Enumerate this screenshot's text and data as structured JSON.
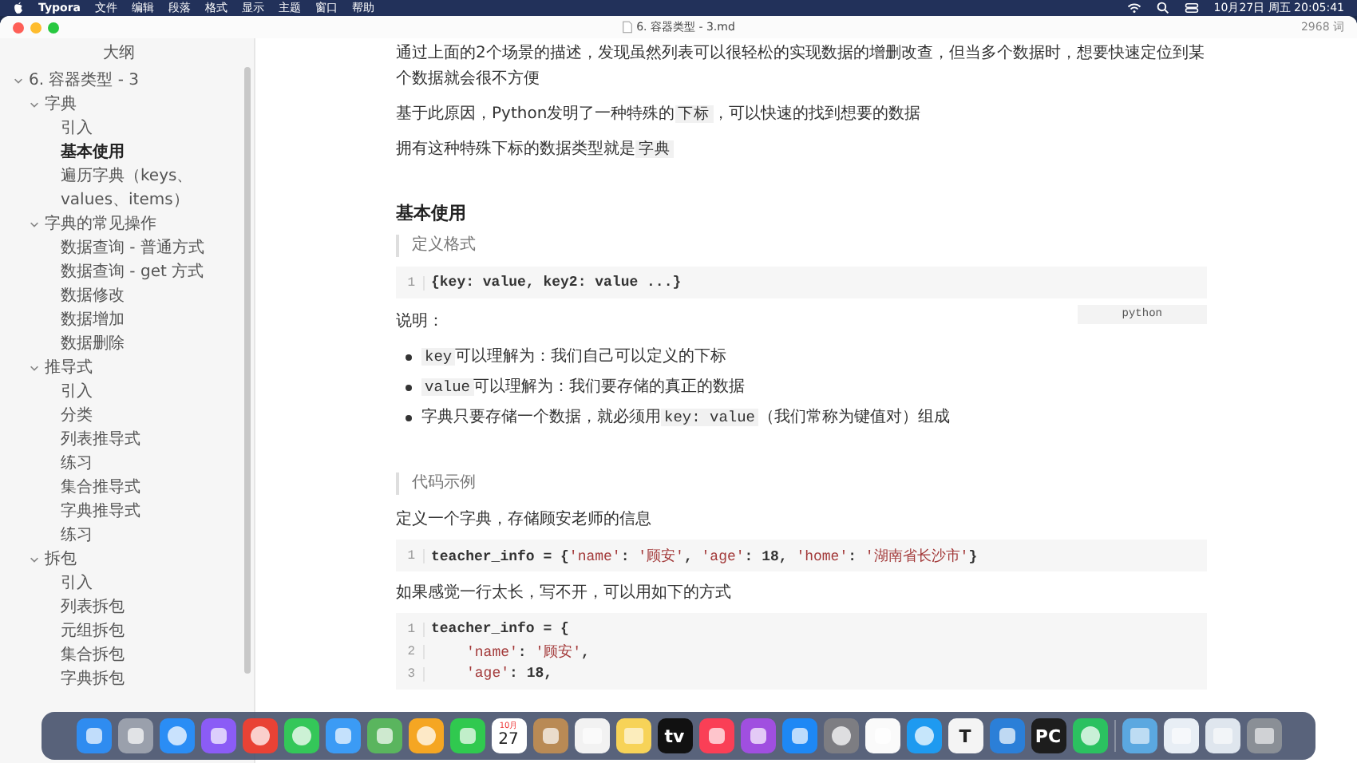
{
  "menubar": {
    "app": "Typora",
    "menus": [
      "文件",
      "编辑",
      "段落",
      "格式",
      "显示",
      "主题",
      "窗口",
      "帮助"
    ],
    "clock": "10月27日 周五  20:05:41"
  },
  "window": {
    "title": "6. 容器类型 - 3.md",
    "word_count": "2968 词"
  },
  "outline": {
    "title": "大纲",
    "items": [
      {
        "label": "6. 容器类型 - 3",
        "selected": false,
        "expanded": true,
        "children": [
          {
            "label": "字典",
            "selected": false,
            "expanded": true,
            "children": [
              {
                "label": "引入",
                "selected": false
              },
              {
                "label": "基本使用",
                "selected": true
              },
              {
                "label": "遍历字典（keys、values、items）",
                "selected": false
              }
            ]
          },
          {
            "label": "字典的常见操作",
            "selected": false,
            "expanded": true,
            "children": [
              {
                "label": "数据查询 - 普通方式",
                "selected": false
              },
              {
                "label": "数据查询 - get 方式",
                "selected": false
              },
              {
                "label": "数据修改",
                "selected": false
              },
              {
                "label": "数据增加",
                "selected": false
              },
              {
                "label": "数据删除",
                "selected": false
              }
            ]
          },
          {
            "label": "推导式",
            "selected": false,
            "expanded": true,
            "children": [
              {
                "label": "引入",
                "selected": false
              },
              {
                "label": "分类",
                "selected": false
              },
              {
                "label": "列表推导式",
                "selected": false
              },
              {
                "label": "练习",
                "selected": false
              },
              {
                "label": "集合推导式",
                "selected": false
              },
              {
                "label": "字典推导式",
                "selected": false
              },
              {
                "label": "练习",
                "selected": false
              }
            ]
          },
          {
            "label": "拆包",
            "selected": false,
            "expanded": true,
            "children": [
              {
                "label": "引入",
                "selected": false
              },
              {
                "label": "列表拆包",
                "selected": false
              },
              {
                "label": "元组拆包",
                "selected": false
              },
              {
                "label": "集合拆包",
                "selected": false
              },
              {
                "label": "字典拆包",
                "selected": false
              }
            ]
          }
        ]
      }
    ]
  },
  "document": [
    {
      "kind": "paragraph",
      "parts": [
        {
          "kind": "text",
          "text": "通过上面的2个场景的描述，发现虽然列表可以很轻松的实现数据的增删改查，但当多个数据时，想要快速定位到某个数据就会很不方便"
        }
      ]
    },
    {
      "kind": "paragraph",
      "parts": [
        {
          "kind": "text",
          "text": "基于此原因，Python发明了一种特殊的"
        },
        {
          "kind": "code",
          "text": "下标"
        },
        {
          "kind": "text",
          "text": "，可以快速的找到想要的数据"
        }
      ]
    },
    {
      "kind": "paragraph",
      "parts": [
        {
          "kind": "text",
          "text": "拥有这种特殊下标的数据类型就是"
        },
        {
          "kind": "code",
          "text": "字典"
        }
      ]
    },
    {
      "kind": "heading",
      "text": "基本使用"
    },
    {
      "kind": "quote",
      "text": "定义格式"
    },
    {
      "kind": "code",
      "language": "python",
      "lines": [
        {
          "number": "1",
          "tokens": [
            {
              "kind": "plain",
              "text": "{key: value, key2: value ...}"
            }
          ]
        }
      ]
    },
    {
      "kind": "paragraph",
      "parts": [
        {
          "kind": "text",
          "text": "说明："
        }
      ]
    },
    {
      "kind": "list",
      "items": [
        {
          "parts": [
            {
              "kind": "code",
              "text": "key"
            },
            {
              "kind": "text",
              "text": "可以理解为：我们自己可以定义的下标"
            }
          ]
        },
        {
          "parts": [
            {
              "kind": "code",
              "text": "value"
            },
            {
              "kind": "text",
              "text": "可以理解为：我们要存储的真正的数据"
            }
          ]
        },
        {
          "parts": [
            {
              "kind": "text",
              "text": "字典只要存储一个数据，就必须用"
            },
            {
              "kind": "code",
              "text": "key: value"
            },
            {
              "kind": "text",
              "text": "（我们常称为键值对）组成"
            }
          ]
        }
      ]
    },
    {
      "kind": "quote",
      "text": "代码示例"
    },
    {
      "kind": "paragraph",
      "parts": [
        {
          "kind": "text",
          "text": "定义一个字典，存储顾安老师的信息"
        }
      ]
    },
    {
      "kind": "code",
      "lines": [
        {
          "number": "1",
          "tokens": [
            {
              "kind": "plain",
              "text": "teacher_info = {"
            },
            {
              "kind": "string",
              "text": "'name'"
            },
            {
              "kind": "plain",
              "text": ": "
            },
            {
              "kind": "string",
              "text": "'顾安'"
            },
            {
              "kind": "plain",
              "text": ", "
            },
            {
              "kind": "string",
              "text": "'age'"
            },
            {
              "kind": "plain",
              "text": ": 18, "
            },
            {
              "kind": "string",
              "text": "'home'"
            },
            {
              "kind": "plain",
              "text": ": "
            },
            {
              "kind": "string",
              "text": "'湖南省长沙市'"
            },
            {
              "kind": "plain",
              "text": "}"
            }
          ]
        }
      ]
    },
    {
      "kind": "paragraph",
      "parts": [
        {
          "kind": "text",
          "text": "如果感觉一行太长，写不开，可以用如下的方式"
        }
      ]
    },
    {
      "kind": "code",
      "lines": [
        {
          "number": "1",
          "tokens": [
            {
              "kind": "plain",
              "text": "teacher_info = {"
            }
          ]
        },
        {
          "number": "2",
          "indented": true,
          "tokens": [
            {
              "kind": "string",
              "text": "'name'"
            },
            {
              "kind": "plain",
              "text": ": "
            },
            {
              "kind": "string",
              "text": "'顾安'"
            },
            {
              "kind": "plain",
              "text": ","
            }
          ]
        },
        {
          "number": "3",
          "indented": true,
          "tokens": [
            {
              "kind": "string",
              "text": "'age'"
            },
            {
              "kind": "plain",
              "text": ": 18,"
            }
          ]
        }
      ]
    }
  ],
  "dock": [
    {
      "kind": "finder",
      "color": "#2f8cf0"
    },
    {
      "kind": "launchpad",
      "color": "#9aa0ac"
    },
    {
      "kind": "compass",
      "color": "#2a8df5"
    },
    {
      "kind": "chat",
      "color": "#8b5cf6"
    },
    {
      "kind": "browser",
      "color": "#e94235"
    },
    {
      "kind": "bubble",
      "color": "#34c759"
    },
    {
      "kind": "mail",
      "color": "#3b9bf5"
    },
    {
      "kind": "maps",
      "color": "#5ab55e"
    },
    {
      "kind": "photos",
      "color": "#f5a623"
    },
    {
      "kind": "video",
      "color": "#30c94f"
    },
    {
      "kind": "calendar",
      "color": "#ffffff",
      "month": "10月",
      "day": "27"
    },
    {
      "kind": "contacts",
      "color": "#b98a55"
    },
    {
      "kind": "list",
      "color": "#f2f2f2"
    },
    {
      "kind": "notes",
      "color": "#f7d358"
    },
    {
      "kind": "tv",
      "color": "#111111",
      "label": "tv"
    },
    {
      "kind": "music",
      "color": "#fa3f56"
    },
    {
      "kind": "podcast",
      "color": "#a04fe0"
    },
    {
      "kind": "store",
      "color": "#1e88f5"
    },
    {
      "kind": "gear",
      "color": "#7d7d82"
    },
    {
      "kind": "penguin",
      "color": "#fafafa"
    },
    {
      "kind": "bubble",
      "color": "#1e9af0"
    },
    {
      "kind": "letter",
      "color": "#f4f4f4",
      "label": "T"
    },
    {
      "kind": "screen",
      "color": "#2b7fd8"
    },
    {
      "kind": "ide",
      "color": "#1d1d1d",
      "label": "PC"
    },
    {
      "kind": "bubble",
      "color": "#2bc160"
    },
    {
      "kind": "separator"
    },
    {
      "kind": "folder",
      "color": "#5ba8e0"
    },
    {
      "kind": "window",
      "color": "#e8eef5"
    },
    {
      "kind": "window",
      "color": "#dfe6ee"
    },
    {
      "kind": "trash",
      "color": "#8a8f96"
    }
  ]
}
